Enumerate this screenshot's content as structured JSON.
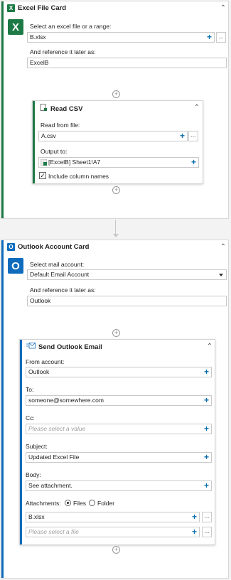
{
  "colors": {
    "excel_green": "#1d7a46",
    "outlook_blue": "#0f6cbd",
    "plus_blue": "#0a6fb0"
  },
  "excel_card": {
    "title": "Excel File Card",
    "badge": "X",
    "collapse_icon": "chevron-up-icon",
    "source_label": "Select an excel file or a range:",
    "source_value": "B.xlsx",
    "ref_label": "And reference it later as:",
    "ref_value": "ExcelB",
    "read_csv": {
      "title": "Read CSV",
      "file_label": "Read from file:",
      "file_value": "A.csv",
      "output_label": "Output to:",
      "output_value": "[ExcelB] Sheet1!A7",
      "include_label": "Include column names",
      "include_checked": true
    }
  },
  "outlook_card": {
    "title": "Outlook Account Card",
    "badge": "O",
    "account_label": "Select mail account:",
    "account_value": "Default Email Account",
    "ref_label": "And reference it later as:",
    "ref_value": "Outlook",
    "send_email": {
      "title": "Send Outlook Email",
      "from_label": "From account:",
      "from_value": "Outlook",
      "to_label": "To:",
      "to_value": "someone@somewhere.com",
      "cc_label": "Cc:",
      "cc_placeholder": "Please select a value",
      "subject_label": "Subject:",
      "subject_value": "Updated Excel File",
      "body_label": "Body:",
      "body_value": "See attachment.",
      "attachments_label": "Attachments:",
      "files_option": "Files",
      "folder_option": "Folder",
      "attachment_value": "B.xlsx",
      "attachment_placeholder": "Please select a file"
    }
  },
  "common": {
    "plus": "+",
    "dots": "...",
    "add": "+",
    "chevron": "^",
    "check": "✓"
  }
}
